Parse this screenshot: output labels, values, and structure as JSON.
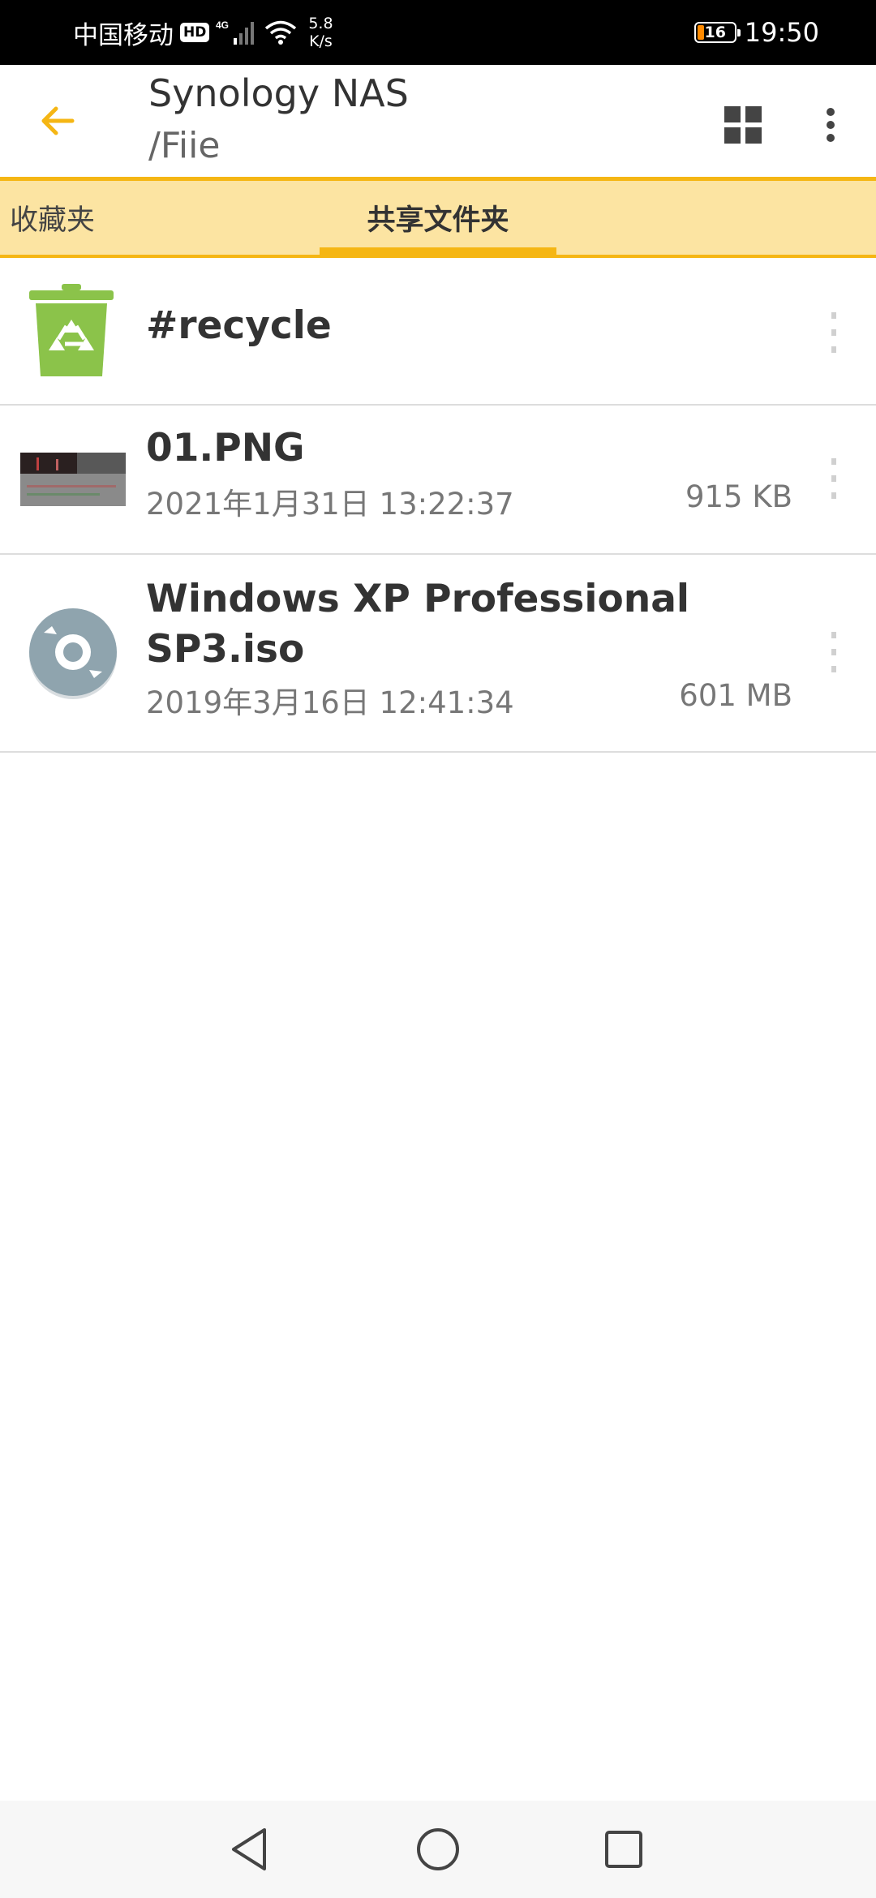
{
  "status_bar": {
    "carrier": "中国移动",
    "hd": "HD",
    "network": "4G",
    "speed_value": "5.8",
    "speed_unit": "K/s",
    "battery": "16",
    "time": "19:50"
  },
  "app_bar": {
    "title": "Synology NAS",
    "subtitle": "/Fiie",
    "accent_color": "#f5b614"
  },
  "tabs": [
    {
      "label": "收藏夹",
      "selected": false
    },
    {
      "label": "共享文件夹",
      "selected": true
    }
  ],
  "files": [
    {
      "name": "#recycle",
      "icon": "recycle-bin-icon"
    },
    {
      "name": "01.PNG",
      "date": "2021年1月31日 13:22:37",
      "size": "915 KB",
      "icon": "image-thumbnail"
    },
    {
      "name": "Windows XP Professional SP3.iso",
      "date": "2019年3月16日 12:41:34",
      "size": "601 MB",
      "icon": "disc-image-icon"
    }
  ],
  "nav_bar": {
    "back_icon": "triangle-back-icon",
    "home_icon": "circle-home-icon",
    "recents_icon": "square-recents-icon"
  }
}
